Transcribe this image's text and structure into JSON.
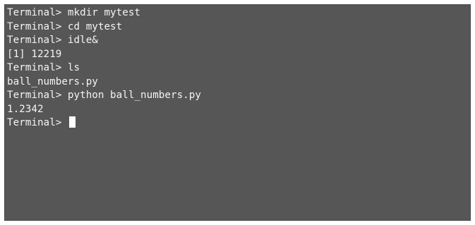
{
  "terminal": {
    "lines": [
      "Terminal> mkdir mytest",
      "Terminal> cd mytest",
      "Terminal> idle&",
      "[1] 12219",
      "Terminal> ls",
      "ball_numbers.py",
      "Terminal> python ball_numbers.py",
      "1.2342"
    ],
    "prompt": "Terminal> ",
    "colors": {
      "background": "#565656",
      "text": "#f4f4f4",
      "cursor": "#ffffff"
    }
  }
}
